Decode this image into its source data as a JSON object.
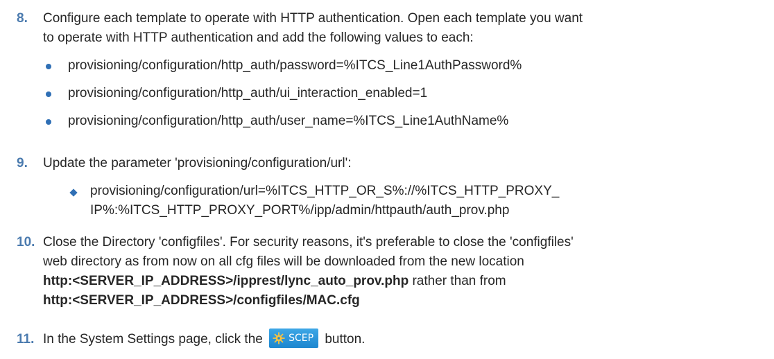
{
  "steps": [
    {
      "number": "8.",
      "line1": "Configure each template to operate with HTTP authentication. Open each template you want",
      "line2": "to operate with HTTP authentication and add the following values to each:",
      "bullets": [
        "provisioning/configuration/http_auth/password=%ITCS_Line1AuthPassword%",
        "provisioning/configuration/http_auth/ui_interaction_enabled=1",
        "provisioning/configuration/http_auth/user_name=%ITCS_Line1AuthName%"
      ]
    },
    {
      "number": "9.",
      "line1": "Update the parameter 'provisioning/configuration/url':",
      "sub_line1": "provisioning/configuration/url=%ITCS_HTTP_OR_S%://%ITCS_HTTP_PROXY_",
      "sub_line2": "IP%:%ITCS_HTTP_PROXY_PORT%/ipp/admin/httpauth/auth_prov.php"
    },
    {
      "number": "10.",
      "line1": "Close the Directory 'configfiles'. For security reasons, it's preferable to close the 'configfiles'",
      "line2": "web directory as from now on all cfg files will be downloaded from the new location",
      "bold1": "http:<SERVER_IP_ADDRESS>/ipprest/lync_auto_prov.php",
      "mid_text": " rather than from",
      "bold2": "http:<SERVER_IP_ADDRESS>/configfiles/MAC.cfg"
    },
    {
      "number": "11.",
      "before": "In the System Settings page, click the ",
      "button_label": "SCEP",
      "after": " button."
    }
  ],
  "colors": {
    "step_number": "#4a7aae",
    "bullet": "#2f6fb5",
    "text": "#262626",
    "scep_button": "#1c86cf",
    "scep_icon": "#f6c343"
  },
  "icons": {
    "scep_button_icon": "gear-icon"
  }
}
